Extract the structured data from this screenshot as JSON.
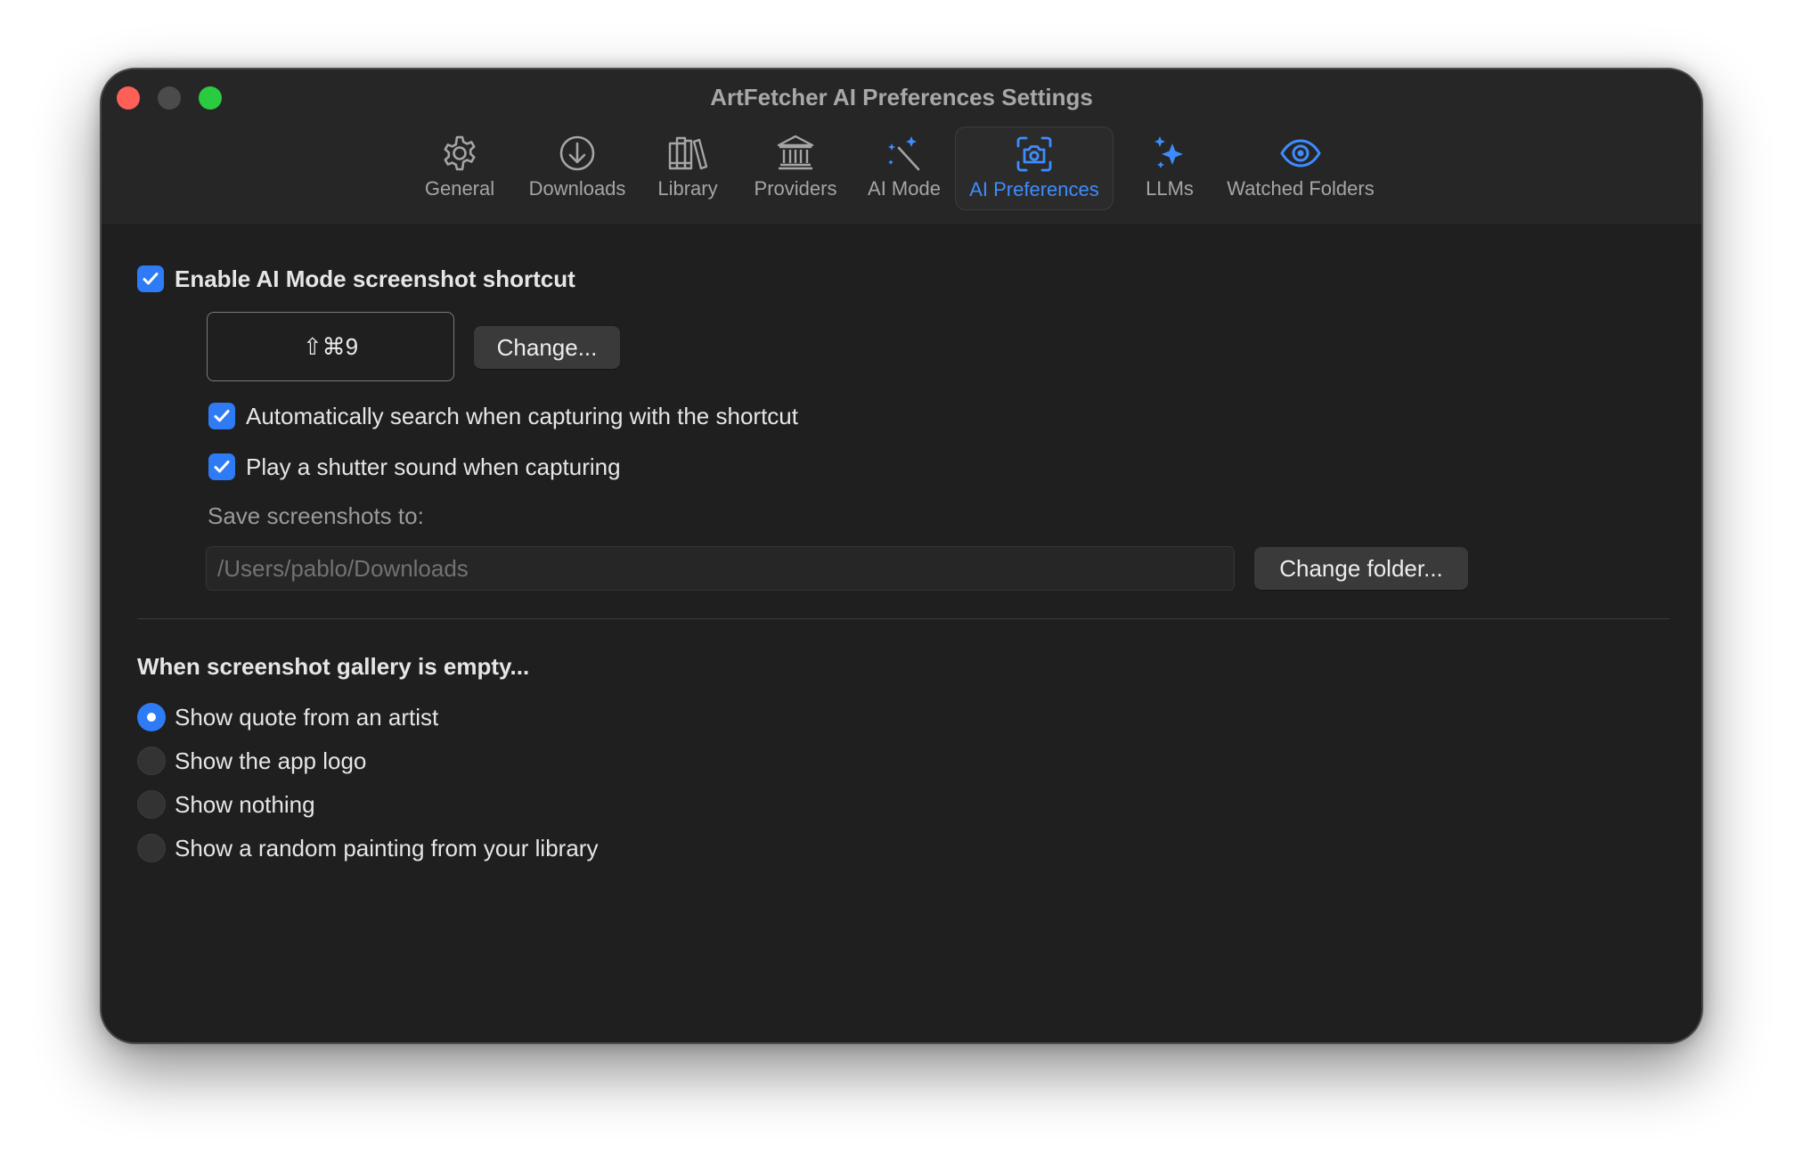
{
  "window": {
    "title": "ArtFetcher AI Preferences Settings"
  },
  "tabs": [
    {
      "label": "General",
      "icon": "gear-icon",
      "selected": false
    },
    {
      "label": "Downloads",
      "icon": "download-icon",
      "selected": false
    },
    {
      "label": "Library",
      "icon": "books-icon",
      "selected": false
    },
    {
      "label": "Providers",
      "icon": "bank-icon",
      "selected": false
    },
    {
      "label": "AI Mode",
      "icon": "magic-wand-icon",
      "selected": false
    },
    {
      "label": "AI Preferences",
      "icon": "camera-viewfinder-icon",
      "selected": true
    },
    {
      "label": "LLMs",
      "icon": "sparkles-icon",
      "selected": false
    },
    {
      "label": "Watched Folders",
      "icon": "eye-icon",
      "selected": false
    }
  ],
  "shortcut": {
    "enable_label": "Enable AI Mode screenshot shortcut",
    "enabled": true,
    "keys": "⇧⌘9",
    "change_label": "Change...",
    "auto_search_label": "Automatically search when capturing with the shortcut",
    "auto_search": true,
    "shutter_label": "Play a shutter sound when capturing",
    "shutter": true,
    "save_label": "Save screenshots to:",
    "save_path": "/Users/pablo/Downloads",
    "change_folder_label": "Change folder..."
  },
  "gallery": {
    "heading": "When screenshot gallery is empty...",
    "options": [
      {
        "label": "Show quote from an artist",
        "selected": true
      },
      {
        "label": "Show the app logo",
        "selected": false
      },
      {
        "label": "Show nothing",
        "selected": false
      },
      {
        "label": "Show a random painting from your library",
        "selected": false
      }
    ]
  },
  "colors": {
    "accent": "#3f8cff",
    "checkbox": "#2f7bf5",
    "window_bg": "#1f1f1f",
    "close": "#fe5f57",
    "maximize": "#2aca41"
  }
}
